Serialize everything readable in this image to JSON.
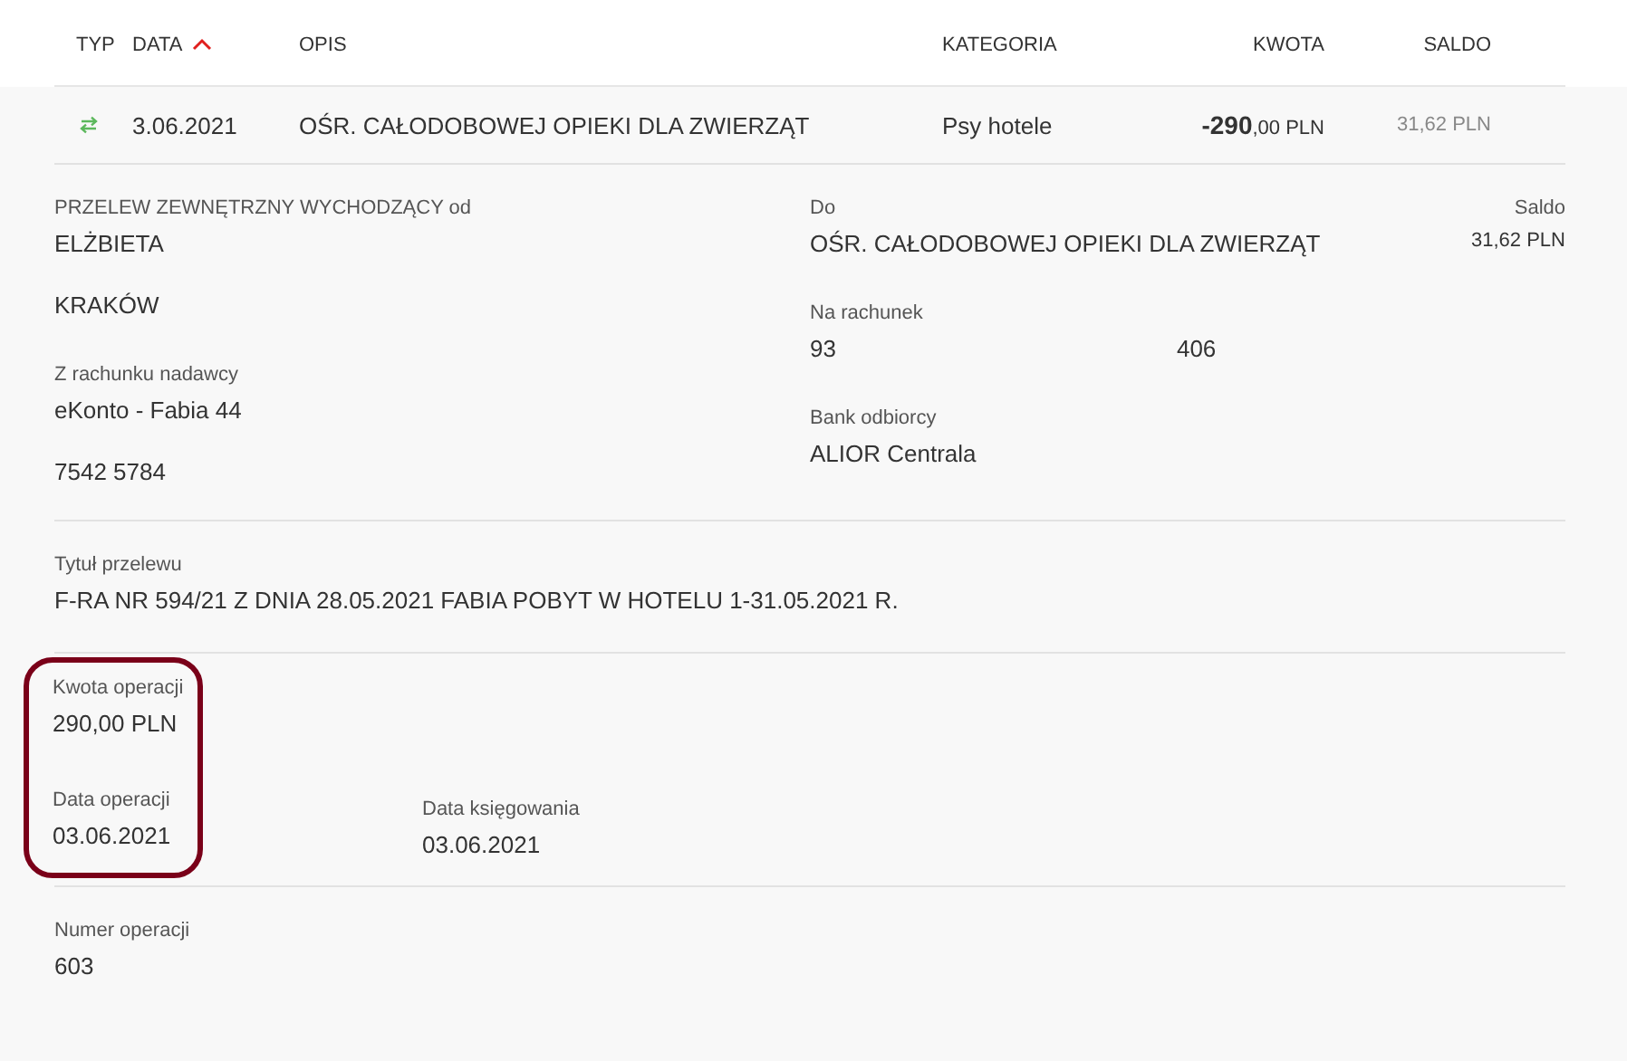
{
  "table": {
    "columns": [
      {
        "label": "TYP",
        "sorted": false
      },
      {
        "label": "DATA",
        "sorted": true
      },
      {
        "label": "OPIS",
        "sorted": false
      },
      {
        "label": "KATEGORIA",
        "sorted": false
      },
      {
        "label": "KWOTA",
        "sorted": false
      },
      {
        "label": "SALDO",
        "sorted": false
      }
    ],
    "row": {
      "date": "3.06.2021",
      "description": "OŚR. CAŁODOBOWEJ OPIEKI DLA ZWIERZĄT",
      "category": "Psy hotele",
      "amount": "**-290**,00 PLN",
      "balance": "31,62 PLN"
    }
  },
  "details": {
    "left": [
      {
        "label": "PRZELEW ZEWNĘTRZNY WYCHODZĄCY od",
        "lines": [
          "ELŻBIETA",
          "KRAKÓW"
        ]
      },
      {
        "label": "Z rachunku nadawcy",
        "lines": [
          "eKonto - Fabia 44",
          "7542 5784"
        ]
      }
    ],
    "right": [
      {
        "label": "Do",
        "lines": [
          "OŚR. CAŁODOBOWEJ OPIEKI DLA ZWIERZĄT"
        ]
      },
      {
        "label": "Na rachunek",
        "lines": [
          "93",
          "406"
        ]
      },
      {
        "label": "Bank odbiorcy",
        "lines": [
          "ALIOR Centrala"
        ]
      }
    ],
    "balance": {
      "label": "Saldo",
      "value": "31,62 PLN"
    }
  },
  "title": {
    "label": "Tytuł przelewu",
    "value": "F-RA NR 594/21 Z DNIA 28.05.2021 FABIA POBYT W HOTELU 1-31.05.2021 R."
  },
  "operation": {
    "highlighted": true,
    "amount": {
      "label": "Kwota operacji",
      "value": "290,00 PLN"
    },
    "date": {
      "label": "Data operacji",
      "value": "03.06.2021"
    },
    "booking_date": {
      "label": "Data księgowania",
      "value": "03.06.2021"
    }
  },
  "number": {
    "label": "Numer operacji",
    "value": "603"
  }
}
